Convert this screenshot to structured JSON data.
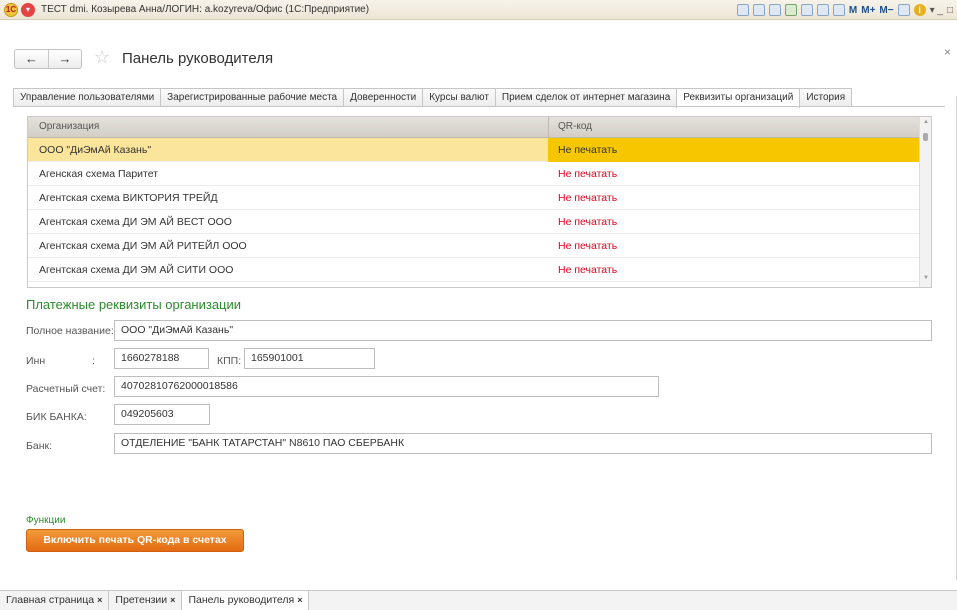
{
  "window": {
    "title": "ТЕСТ dmi. Козырева Анна/ЛОГИН: a.kozyreva/Офис  (1С:Предприятие)",
    "toolbar_labels": [
      "M",
      "M+",
      "M−"
    ]
  },
  "page": {
    "title": "Панель руководителя"
  },
  "tabs": [
    {
      "label": "Управление пользователями"
    },
    {
      "label": "Зарегистрированные рабочие места"
    },
    {
      "label": "Доверенности"
    },
    {
      "label": "Курсы валют"
    },
    {
      "label": "Прием сделок от интернет магазина"
    },
    {
      "label": "Реквизиты организаций",
      "active": true
    },
    {
      "label": "История"
    }
  ],
  "grid": {
    "columns": {
      "org": "Организация",
      "qr": "QR-код"
    },
    "rows": [
      {
        "org": "ООО \"ДиЭмАй Казань\"",
        "qr": "Не печатать",
        "selected": true
      },
      {
        "org": "Агенская схема Паритет",
        "qr": "Не печатать"
      },
      {
        "org": "Агентская схема ВИКТОРИЯ ТРЕЙД",
        "qr": "Не печатать"
      },
      {
        "org": "Агентская схема ДИ ЭМ АЙ ВЕСТ ООО",
        "qr": "Не печатать"
      },
      {
        "org": "Агентская схема ДИ ЭМ АЙ РИТЕЙЛ ООО",
        "qr": "Не печатать"
      },
      {
        "org": "Агентская схема ДИ ЭМ АЙ СИТИ ООО",
        "qr": "Не печатать"
      }
    ]
  },
  "details": {
    "section_title": "Платежные реквизиты организации",
    "full_name_label": "Полное название:",
    "full_name_value": "ООО \"ДиЭмАй Казань\"",
    "inn_label": "Инн",
    "inn_colon": ":",
    "inn_value": "1660278188",
    "kpp_label": "КПП:",
    "kpp_value": "165901001",
    "account_label": "Расчетный счет:",
    "account_value": "40702810762000018586",
    "bik_label": "БИК БАНКА:",
    "bik_value": "049205603",
    "bank_label": "Банк:",
    "bank_value": "ОТДЕЛЕНИЕ \"БАНК ТАТАРСТАН\" N8610 ПАО СБЕРБАНК"
  },
  "functions": {
    "label": "Функции",
    "button": "Включить печать QR-кода в счетах"
  },
  "bottom_tabs": [
    {
      "label": "Главная страница"
    },
    {
      "label": "Претензии"
    },
    {
      "label": "Панель руководителя",
      "active": true
    }
  ],
  "close_glyph": "×",
  "colors": {
    "accent_green": "#2c8a2c",
    "selection_yellow": "#f6c700",
    "qr_red": "#e0001a",
    "button_orange": "#e36a12"
  }
}
